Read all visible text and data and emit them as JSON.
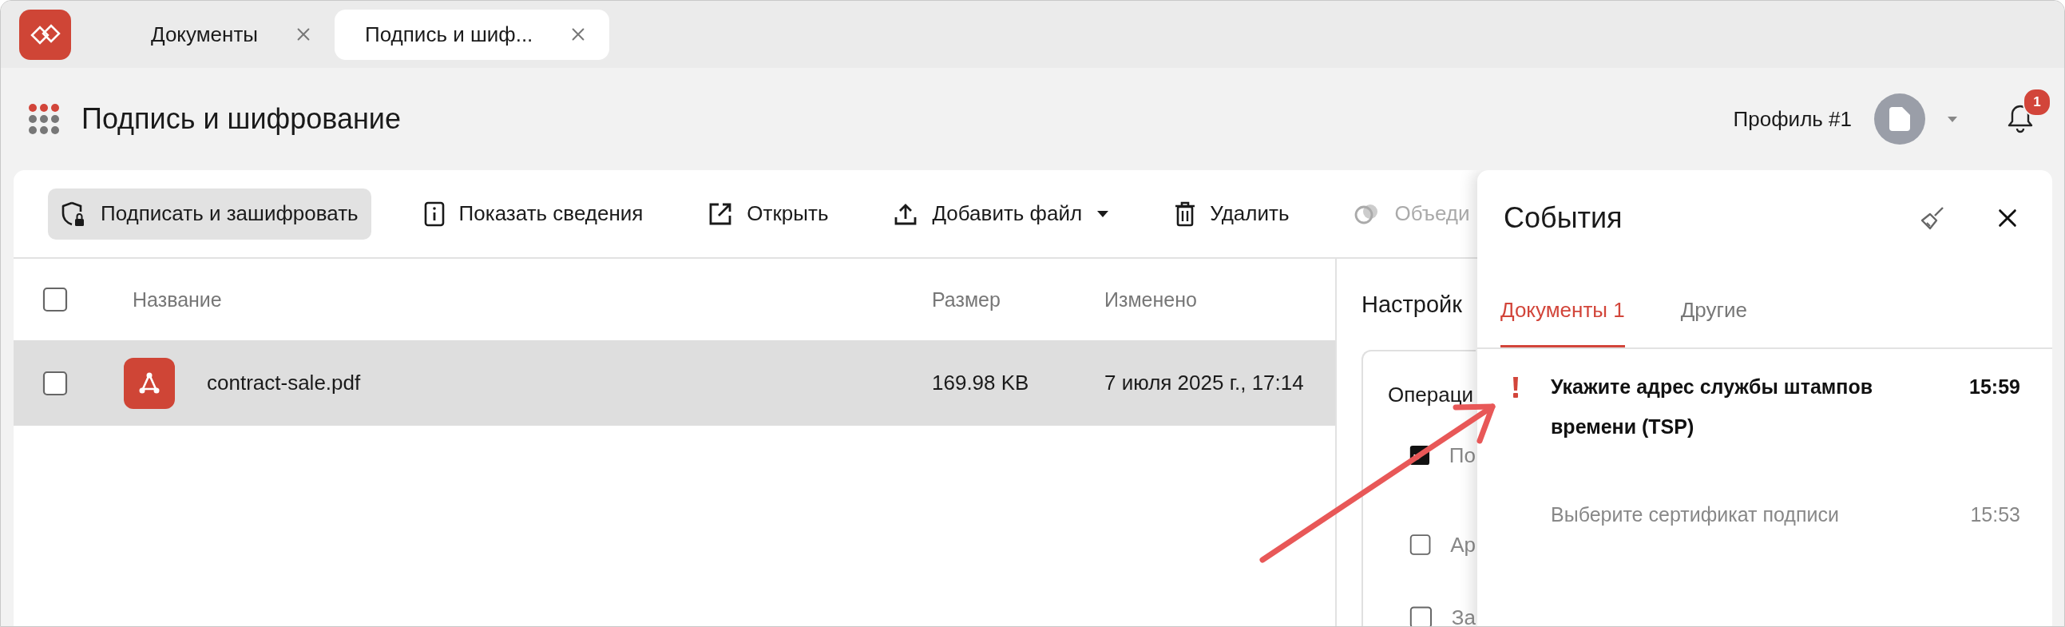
{
  "app_tabs": [
    {
      "label": "Документы",
      "selected": false
    },
    {
      "label": "Подпись и шиф...",
      "selected": true
    }
  ],
  "header": {
    "title": "Подпись и шифрование",
    "profile": "Профиль #1",
    "notification_count": "1"
  },
  "toolbar": [
    {
      "label": "Подписать и зашифровать",
      "kind": "shield-lock",
      "selected": true,
      "disabled": false,
      "dropdown": false
    },
    {
      "label": "Показать сведения",
      "kind": "info",
      "selected": false,
      "disabled": false,
      "dropdown": false
    },
    {
      "label": "Открыть",
      "kind": "external",
      "selected": false,
      "disabled": false,
      "dropdown": false
    },
    {
      "label": "Добавить файл",
      "kind": "upload",
      "selected": false,
      "disabled": false,
      "dropdown": true
    },
    {
      "label": "Удалить",
      "kind": "trash",
      "selected": false,
      "disabled": false,
      "dropdown": false
    },
    {
      "label": "Объеди",
      "kind": "circles",
      "selected": false,
      "disabled": true,
      "dropdown": false
    }
  ],
  "table": {
    "all_checked": false,
    "columns": [
      "Название",
      "Размер",
      "Изменено"
    ],
    "rows": [
      {
        "name": "contract-sale.pdf",
        "size": "169.98 KB",
        "modified": "7 июля 2025 г., 17:14",
        "selected": true,
        "checked": false
      }
    ]
  },
  "settings": {
    "title": "Настройк",
    "section": "Операци",
    "options": [
      {
        "label": "По",
        "checked": true
      },
      {
        "label": "Ар",
        "checked": false
      },
      {
        "label": "За",
        "checked": false
      }
    ]
  },
  "events": {
    "title": "События",
    "tabs": [
      {
        "label": "Документы 1",
        "selected": true
      },
      {
        "label": "Другие",
        "selected": false
      }
    ],
    "items": [
      {
        "text": "Укажите адрес службы штампов времени (TSP)",
        "time": "15:59",
        "unread": true
      },
      {
        "text": "Выберите сертификат подписи",
        "time": "15:53",
        "unread": false
      }
    ]
  }
}
